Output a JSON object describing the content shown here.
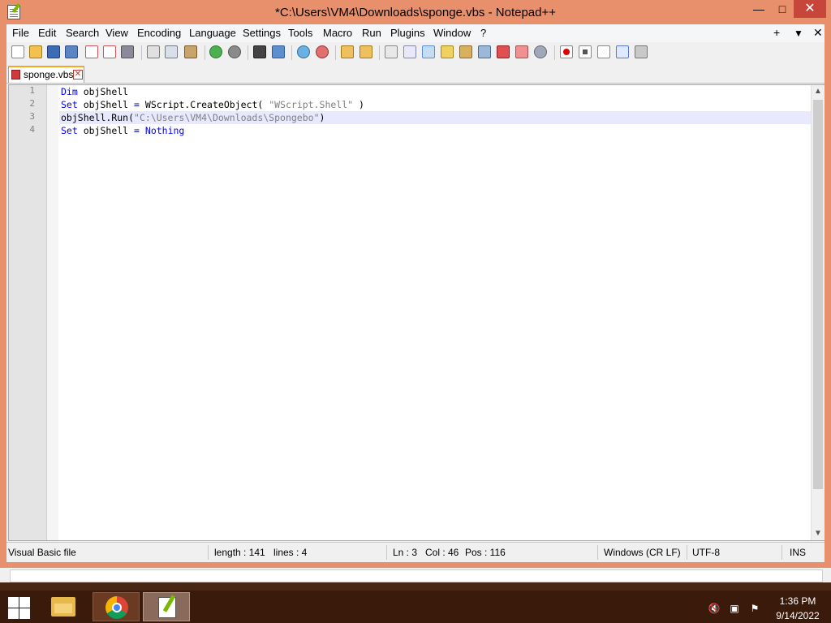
{
  "window": {
    "title": "*C:\\Users\\VM4\\Downloads\\sponge.vbs - Notepad++",
    "minimize_glyph": "—",
    "maximize_glyph": "□",
    "close_glyph": "✕"
  },
  "menu": {
    "items": [
      "File",
      "Edit",
      "Search",
      "View",
      "Encoding",
      "Language",
      "Settings",
      "Tools",
      "Macro",
      "Run",
      "Plugins",
      "Window",
      "?"
    ],
    "right_plus": "+",
    "right_dropdown": "▼",
    "right_close": "✕"
  },
  "toolbar": {
    "icons": [
      "new-file-icon",
      "open-file-icon",
      "save-icon",
      "save-all-icon",
      "close-icon",
      "close-all-icon",
      "print-icon",
      "cut-icon",
      "copy-icon",
      "paste-icon",
      "undo-icon",
      "redo-icon",
      "find-icon",
      "replace-icon",
      "zoom-in-icon",
      "zoom-out-icon",
      "sync-vertical-icon",
      "sync-horizontal-icon",
      "word-wrap-icon",
      "show-all-characters-icon",
      "indent-guide-icon",
      "user-defined-language-icon",
      "document-map-icon",
      "function-list-icon",
      "folder-as-workspace-icon",
      "monitoring-icon",
      "record-macro-icon",
      "stop-record-icon",
      "playback-macro-icon",
      "run-macro-multiple-icon",
      "save-macro-icon"
    ]
  },
  "tab": {
    "label": "sponge.vbs",
    "close_glyph": "✕"
  },
  "editor": {
    "line_numbers": [
      "1",
      "2",
      "3",
      "4"
    ],
    "lines": [
      {
        "keyword": "Dim",
        "rest": " objShell"
      },
      {
        "keyword": "Set",
        "rest": " objShell ",
        "op": "=",
        "after": " WScript.CreateObject( ",
        "string": "\"WScript.Shell\"",
        "tail": " )"
      },
      {
        "text": "objShell.Run(",
        "string": "\"C:\\Users\\VM4\\Downloads\\Spongebo\"",
        "tail": ")"
      },
      {
        "keyword": "Set",
        "rest": " objShell ",
        "op": "=",
        "keyword2": " Nothing"
      }
    ],
    "scroll_up": "▲",
    "scroll_down": "▼"
  },
  "status": {
    "file_type": "Visual Basic file",
    "length": "length : 141",
    "lines": "lines : 4",
    "ln": "Ln : 3",
    "col": "Col : 46",
    "pos": "Pos : 116",
    "eol": "Windows (CR LF)",
    "encoding": "UTF-8",
    "mode": "INS"
  },
  "taskbar": {
    "time": "1:36 PM",
    "date": "9/14/2022",
    "tray_icons": [
      "volume-muted-icon",
      "network-icon",
      "action-center-flag-icon"
    ]
  },
  "colors": {
    "window_frame": "#e8906c",
    "keyword": "#0000ff",
    "string": "#808080",
    "current_line": "#e8e8ff",
    "taskbar": "#3a1a0a"
  }
}
